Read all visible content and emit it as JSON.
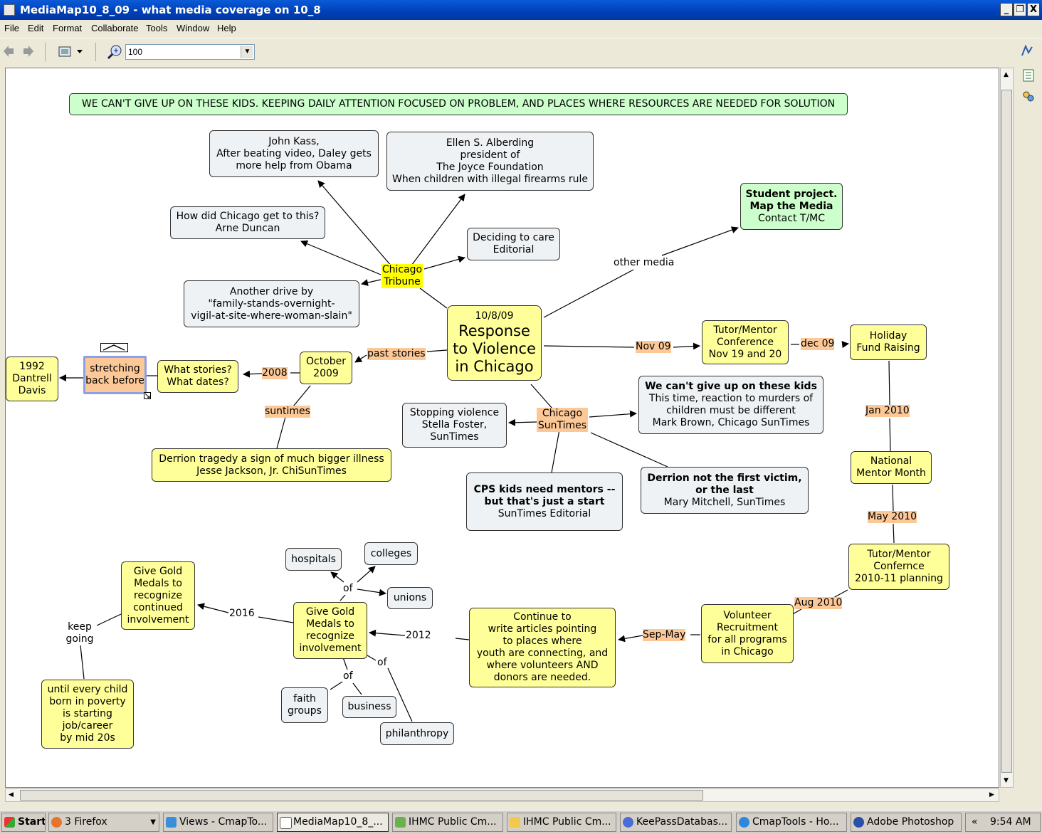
{
  "window": {
    "title": "MediaMap10_8_09 - what media coverage on 10_8",
    "minimize": "_",
    "restore": "❐",
    "close": "X"
  },
  "menu": [
    "File",
    "Edit",
    "Format",
    "Collaborate",
    "Tools",
    "Window",
    "Help"
  ],
  "toolbar": {
    "zoom_value": "100",
    "dropdown": "▼"
  },
  "banner": "WE CAN'T GIVE UP ON THESE KIDS.  KEEPING DAILY ATTENTION FOCUSED ON PROBLEM, AND PLACES WHERE RESOURCES ARE NEEDED FOR SOLUTION",
  "nodes": {
    "center": {
      "date": "10/8/09",
      "title1": "Response",
      "title2": "to Violence",
      "title3": "in Chicago"
    },
    "kass": [
      "John Kass,",
      "After beating video, Daley gets",
      "more help from Obama"
    ],
    "alberding": [
      "Ellen S. Alberding",
      "president of",
      "The Joyce Foundation",
      "When children with illegal firearms rule"
    ],
    "duncan": [
      "How did Chicago get to this?",
      "Arne Duncan"
    ],
    "deciding": [
      "Deciding to care",
      "Editorial"
    ],
    "student": [
      "Student project.",
      "Map the Media",
      "Contact T/MC"
    ],
    "vigil": [
      "Another drive by",
      "\"family-stands-overnight-",
      "vigil-at-site-where-woman-slain\""
    ],
    "tutor1": [
      "Tutor/Mentor",
      "Conference",
      "Nov 19 and 20"
    ],
    "holiday": [
      "Holiday",
      "Fund Raising"
    ],
    "oct2009": [
      "October",
      "2009"
    ],
    "whatstories": [
      "What stories?",
      "What dates?"
    ],
    "stretching": [
      "stretching",
      "back before"
    ],
    "davis": [
      "1992",
      "Dantrell",
      "Davis"
    ],
    "cantgiveup": [
      "We can't give up on these kids",
      "This time, reaction to murders of",
      "children must be different",
      "Mark Brown, Chicago SunTimes"
    ],
    "stopping": [
      "Stopping violence",
      "Stella Foster,",
      "SunTimes"
    ],
    "derrion": [
      "Derrion tragedy a sign of much bigger illness",
      "Jesse Jackson, Jr. ChiSunTimes"
    ],
    "cpskids": [
      "CPS kids need mentors --",
      "but that's just a start",
      "SunTimes Editorial"
    ],
    "notfirst": [
      "Derrion not the first victim,",
      "or the last",
      "Mary Mitchell, SunTimes"
    ],
    "national": [
      "National",
      "Mentor Month"
    ],
    "tutor2": [
      "Tutor/Mentor",
      "Confernce",
      "2010-11 planning"
    ],
    "volunteer": [
      "Volunteer",
      "Recruitment",
      "for all programs",
      "in Chicago"
    ],
    "continue": [
      "Continue to",
      "write articles pointing",
      "to places where",
      "youth are connecting, and",
      "where volunteers AND",
      "donors are needed."
    ],
    "gold1": [
      "Give Gold",
      "Medals to",
      "recognize",
      "involvement"
    ],
    "gold2": [
      "Give Gold",
      "Medals to",
      "recognize",
      "continued",
      "involvement"
    ],
    "untilevery": [
      "until every child",
      "born in poverty",
      "is starting",
      "job/career",
      "by mid 20s"
    ],
    "hospitals": "hospitals",
    "colleges": "colleges",
    "unions": "unions",
    "faith": [
      "faith",
      "groups"
    ],
    "business": "business",
    "philanthropy": "philanthropy"
  },
  "labels": {
    "tribune": [
      "Chicago",
      "Tribune"
    ],
    "suntimes_node": [
      "Chicago",
      "SunTimes"
    ],
    "other_media": "other media",
    "past_stories": "past stories",
    "nov09": "Nov 09",
    "dec09": "dec 09",
    "y2008": "2008",
    "suntimes": "suntimes",
    "jan2010": "Jan 2010",
    "may2010": "May 2010",
    "aug2010": "Aug 2010",
    "sepmay": "Sep-May",
    "y2012": "2012",
    "y2016": "2016",
    "keepgoing": [
      "keep",
      "going"
    ],
    "of1": "of",
    "of2": "of",
    "of3": "of"
  },
  "taskbar": {
    "start": "Start",
    "tasks": [
      "3 Firefox",
      "Views - CmapTo...",
      "MediaMap10_8_...",
      "IHMC Public Cm...",
      "IHMC Public Cm...",
      "KeePassDatabas...",
      "CmapTools - Ho...",
      "Adobe Photoshop"
    ],
    "clock": "9:54 AM",
    "tray_arrows": "«"
  },
  "colors": {
    "concept_yellow": "#ffff99",
    "concept_blue": "#eef2f4",
    "concept_green": "#ccffcc",
    "link_orange": "#fcc897",
    "highlight_yellow": "#ffff00",
    "titlebar_blue": "#0a5ad8"
  }
}
